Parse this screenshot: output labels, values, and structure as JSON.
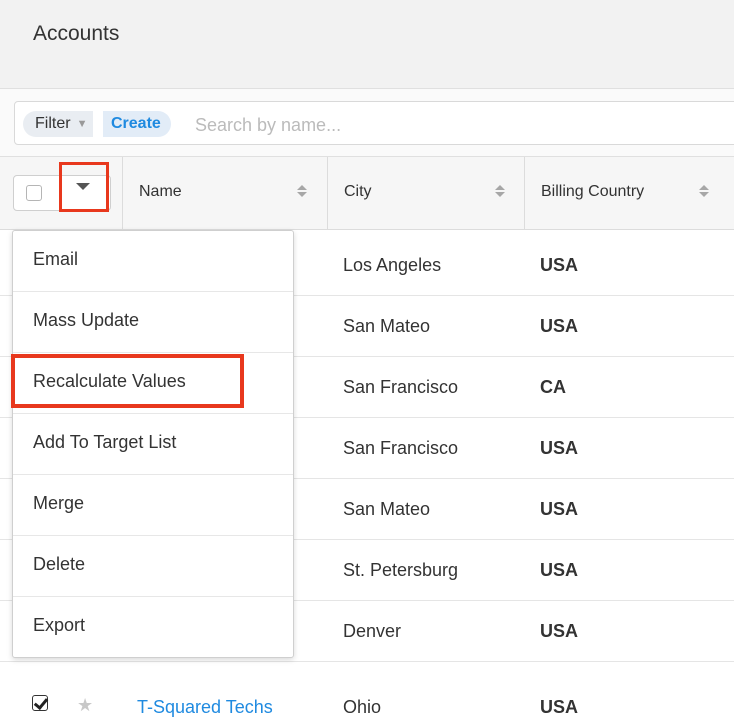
{
  "header": {
    "title": "Accounts"
  },
  "filterbar": {
    "filter_label": "Filter",
    "create_label": "Create",
    "search_placeholder": "Search by name..."
  },
  "table": {
    "columns": [
      "Name",
      "City",
      "Billing Country"
    ],
    "rows": [
      {
        "name": "",
        "city": "Los Angeles",
        "country": "USA"
      },
      {
        "name": "",
        "city": "San Mateo",
        "country": "USA"
      },
      {
        "name": "",
        "city": "San Francisco",
        "country": "CA"
      },
      {
        "name": "",
        "city": "San Francisco",
        "country": "USA"
      },
      {
        "name": "",
        "city": "San Mateo",
        "country": "USA"
      },
      {
        "name": "",
        "city": "St. Petersburg",
        "country": "USA"
      },
      {
        "name": "",
        "city": "Denver",
        "country": "USA"
      },
      {
        "name": "T-Squared Techs",
        "city": "Ohio",
        "country": "USA",
        "checked": true
      }
    ],
    "ellipsis": "..."
  },
  "mass_actions_menu": {
    "items": [
      "Email",
      "Mass Update",
      "Recalculate Values",
      "Add To Target List",
      "Merge",
      "Delete",
      "Export"
    ]
  },
  "icons": {
    "star": "star-icon",
    "caret": "chevron-down-icon",
    "sort": "sort-icon"
  },
  "colors": {
    "accent_link": "#1f8ae0",
    "highlight_red": "#e8381d"
  }
}
